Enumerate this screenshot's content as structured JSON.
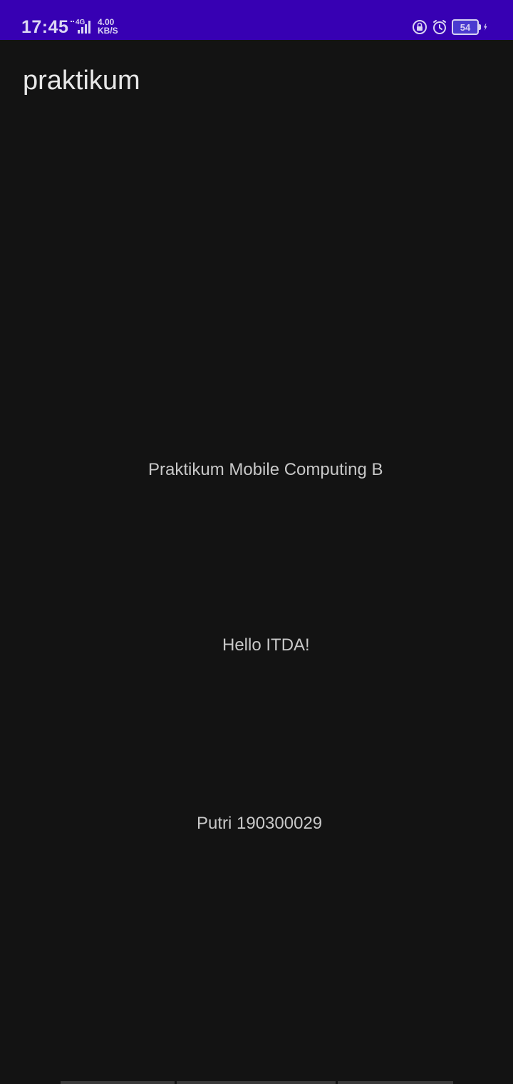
{
  "status_bar": {
    "time": "17:45",
    "network_type": "4G",
    "speed_value": "4.00",
    "speed_unit": "KB/S",
    "battery_level": "54",
    "icons": [
      "rotation-lock-icon",
      "alarm-icon",
      "battery-icon",
      "charging-icon"
    ],
    "background_color": "#3700b3"
  },
  "app_bar": {
    "title": "praktikum"
  },
  "content": {
    "lines": [
      "Praktikum Mobile Computing B",
      "Hello ITDA!",
      "Putri 190300029"
    ]
  },
  "theme": {
    "background": "#131313",
    "text_primary": "#e8e8e8",
    "text_secondary": "#c8c8c8"
  }
}
